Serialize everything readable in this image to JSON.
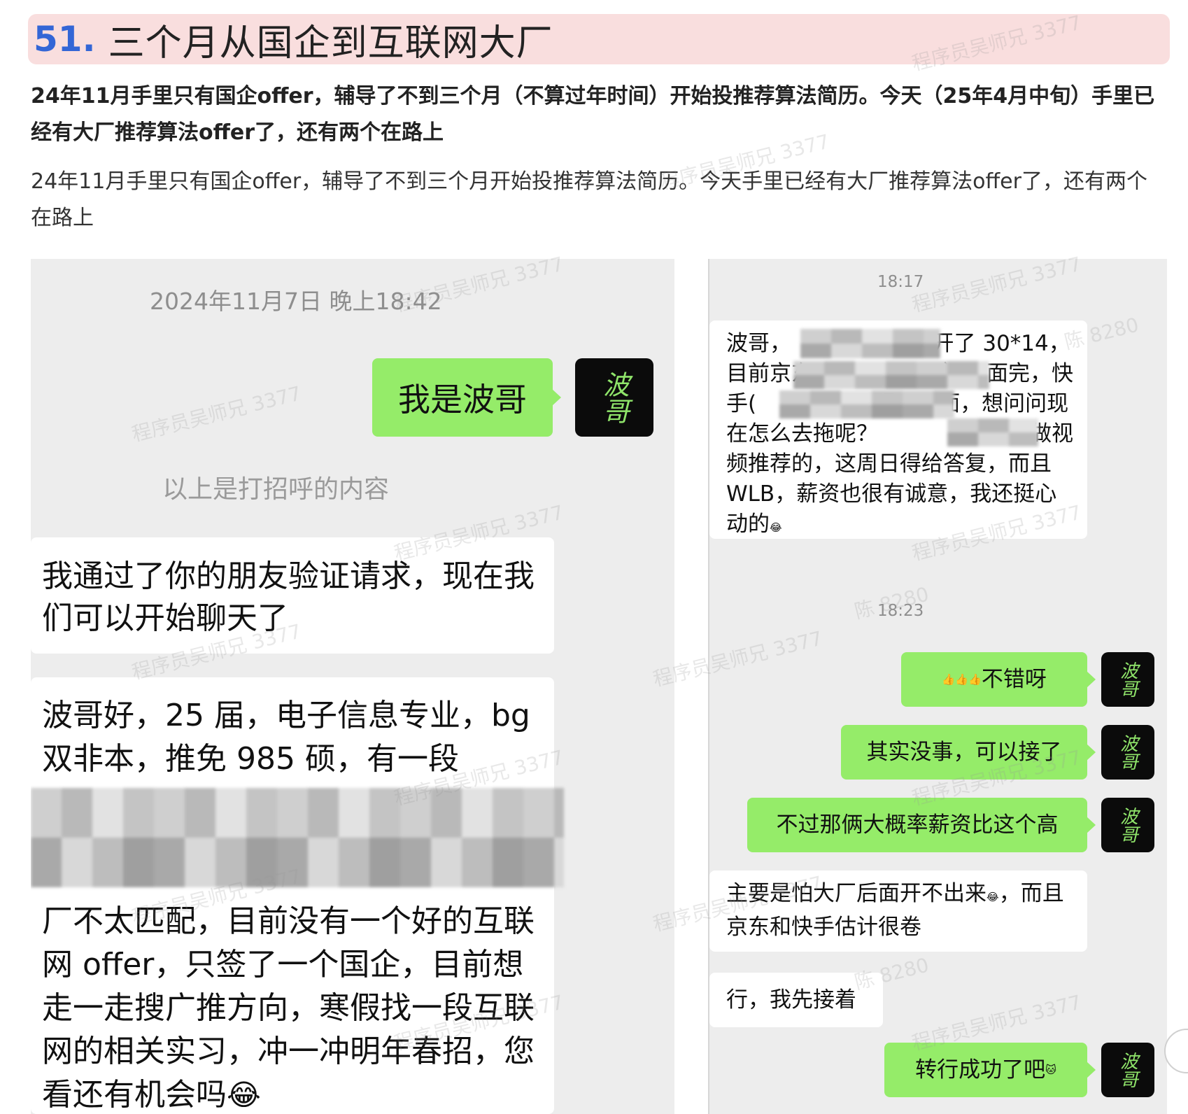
{
  "header": {
    "number": "51.",
    "title": "三个月从国企到互联网大厂"
  },
  "summary": {
    "bold": "24年11月手里只有国企offer，辅导了不到三个月（不算过年时间）开始投推荐算法简历。今天（25年4月中旬）手里已经有大厂推荐算法offer了，还有两个在路上",
    "plain": "24年11月手里只有国企offer，辅导了不到三个月开始投推荐算法简历。今天手里已经有大厂推荐算法offer了，还有两个在路上"
  },
  "left_chat": {
    "timestamp": "2024年11月7日 晚上18:42",
    "self_message": "我是波哥",
    "avatar_text": "波哥",
    "greeting_note": "以上是打招呼的内容",
    "system_message": "我通过了你的朋友验证请求，现在我们可以开始聊天了",
    "intro_message_top": "波哥好，25 届，电子信息专业，bg 双非本，推免 985 硕，有一段",
    "intro_message_bottom": "厂不太匹配，目前没有一个好的互联网 offer，只签了一个国企，目前想走一走搜广推方向，寒假找一段互联网的相关实习，冲一冲明年春招，您看还有机会吗",
    "intro_emoji": "😂"
  },
  "right_chat": {
    "timestamp_1": "18:17",
    "incoming_1": "波哥，　　　　这边给开了 30*14，目前京东　　　　　　）一面完，快手(　　　　　)明天三面，想问问现在怎么去拖呢？　　　　　边是做视频推荐的，这周日得给答复，而且 WLB，薪资也很有诚意，我还挺心动的",
    "incoming_1_emoji": "😂",
    "timestamp_2": "18:23",
    "reply_1_emoji": "👍👍👍",
    "reply_1_text": "不错呀",
    "reply_2": "其实没事，可以接了",
    "reply_3": "不过那俩大概率薪资比这个高",
    "incoming_2_a": "主要是怕大厂后面开不出来",
    "incoming_2_emoji": "😂",
    "incoming_2_b": "，而且京东和快手估计很卷",
    "incoming_3": "行，我先接着",
    "reply_4_text": "转行成功了吧",
    "reply_4_emoji": "🐱",
    "avatar_text": "波哥"
  },
  "watermarks": [
    "程序员吴师兄 3377",
    "陈 8280"
  ],
  "colors": {
    "title_bg": "#f9dede",
    "title_number": "#3366d6",
    "chat_bg": "#ededed",
    "bubble_green": "#95ec69",
    "bubble_white": "#ffffff",
    "avatar_bg": "#0b0b0b"
  }
}
